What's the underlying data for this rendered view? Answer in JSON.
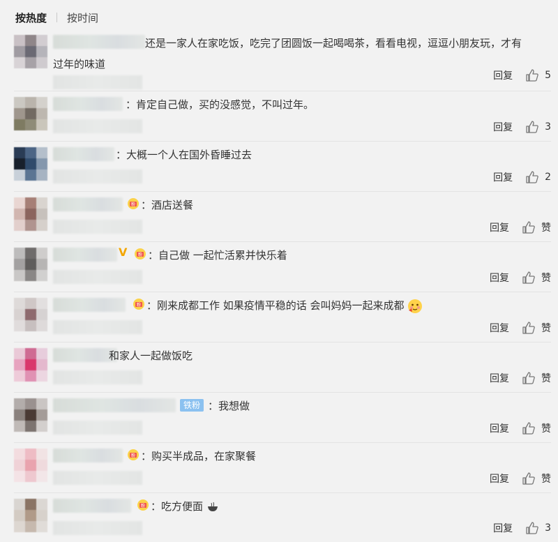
{
  "sort_tabs": {
    "hot": "按热度",
    "time": "按时间"
  },
  "reply_label": "回复",
  "like_label": "赞",
  "fan_badge": "铁粉",
  "comments": [
    {
      "text": "还是一家人在家吃饭，吃完了团圆饭一起喝喝茶，看看电视，逗逗小朋友玩，才有过年的味道",
      "likes": "5"
    },
    {
      "text": "：肯定自己做，买的没感觉，不叫过年。",
      "likes": "3"
    },
    {
      "text": "：大概一个人在国外昏睡过去",
      "likes": "2"
    },
    {
      "text": "：酒店送餐",
      "likes": "赞"
    },
    {
      "text": "：自己做 一起忙活累并快乐着",
      "likes": "赞"
    },
    {
      "text": "：刚来成都工作 如果疫情平稳的话 会叫妈妈一起来成都",
      "likes": "赞"
    },
    {
      "text": "和家人一起做饭吃",
      "likes": "赞"
    },
    {
      "text": "：我想做",
      "likes": "赞"
    },
    {
      "text": "：购买半成品，在家聚餐",
      "likes": "赞"
    },
    {
      "text": "：吃方便面",
      "likes": "3"
    }
  ],
  "icons": {
    "thumb": "thumbs-up-icon",
    "medal": "fan-medal-icon",
    "verified": "verified-v-icon"
  }
}
